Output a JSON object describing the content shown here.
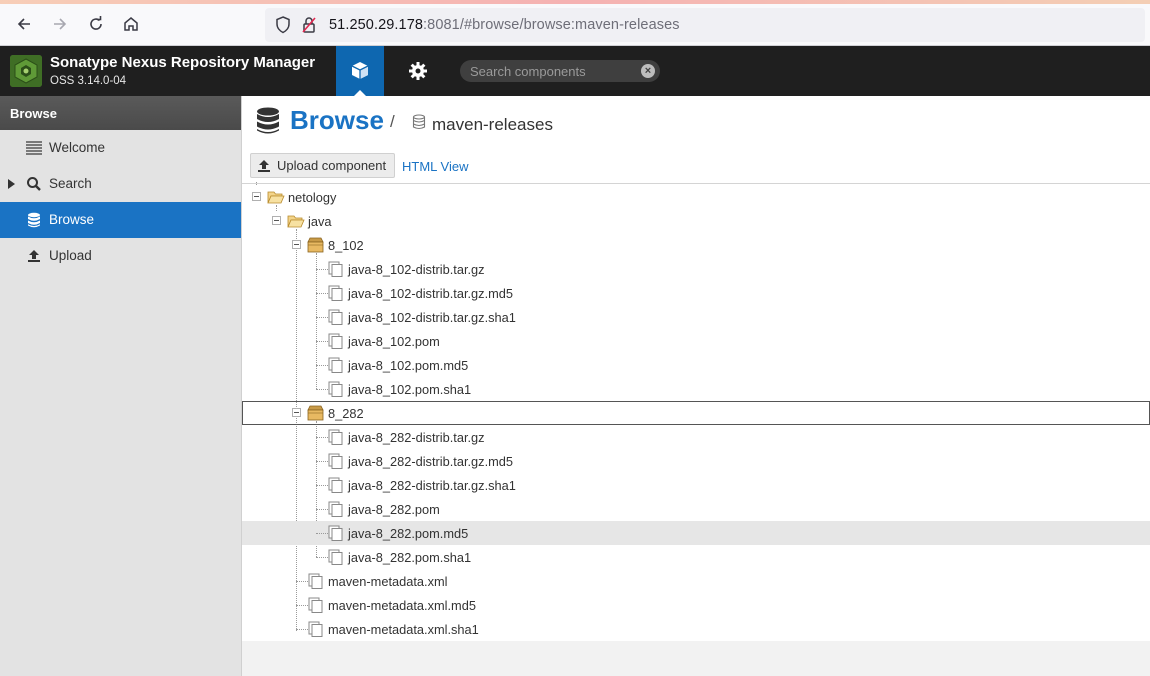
{
  "browser": {
    "url_host": "51.250.29.178",
    "url_rest": ":8081/#browse/browse:maven-releases"
  },
  "header": {
    "app_title": "Sonatype Nexus Repository Manager",
    "app_version": "OSS 3.14.0-04",
    "search_placeholder": "Search components"
  },
  "sidebar": {
    "heading": "Browse",
    "items": [
      {
        "label": "Welcome"
      },
      {
        "label": "Search"
      },
      {
        "label": "Browse"
      },
      {
        "label": "Upload"
      }
    ]
  },
  "main": {
    "title": "Browse",
    "separator": "/",
    "repository": "maven-releases",
    "upload_label": "Upload component",
    "html_view_label": "HTML View"
  },
  "tree": [
    {
      "label": "netology",
      "type": "folder-open"
    },
    {
      "label": "java",
      "type": "folder-open"
    },
    {
      "label": "8_102",
      "type": "component"
    },
    {
      "label": "java-8_102-distrib.tar.gz",
      "type": "asset"
    },
    {
      "label": "java-8_102-distrib.tar.gz.md5",
      "type": "asset"
    },
    {
      "label": "java-8_102-distrib.tar.gz.sha1",
      "type": "asset"
    },
    {
      "label": "java-8_102.pom",
      "type": "asset"
    },
    {
      "label": "java-8_102.pom.md5",
      "type": "asset"
    },
    {
      "label": "java-8_102.pom.sha1",
      "type": "asset"
    },
    {
      "label": "8_282",
      "type": "component"
    },
    {
      "label": "java-8_282-distrib.tar.gz",
      "type": "asset"
    },
    {
      "label": "java-8_282-distrib.tar.gz.md5",
      "type": "asset"
    },
    {
      "label": "java-8_282-distrib.tar.gz.sha1",
      "type": "asset"
    },
    {
      "label": "java-8_282.pom",
      "type": "asset"
    },
    {
      "label": "java-8_282.pom.md5",
      "type": "asset"
    },
    {
      "label": "java-8_282.pom.sha1",
      "type": "asset"
    },
    {
      "label": "maven-metadata.xml",
      "type": "asset"
    },
    {
      "label": "maven-metadata.xml.md5",
      "type": "asset"
    },
    {
      "label": "maven-metadata.xml.sha1",
      "type": "asset"
    }
  ],
  "colors": {
    "accent": "#1a73c4",
    "header_bg": "#1f1f1f"
  }
}
